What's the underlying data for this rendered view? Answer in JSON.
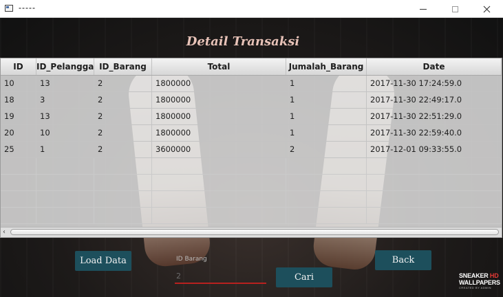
{
  "window": {
    "title": "-----"
  },
  "page": {
    "heading": "Detail Transaksi"
  },
  "table": {
    "columns": [
      "ID",
      "ID_Pelanggan",
      "ID_Barang",
      "Total",
      "Jumalah_Barang",
      "Date"
    ],
    "rows": [
      [
        "10",
        "13",
        "2",
        "1800000",
        "1",
        "2017-11-30 17:24:59.0"
      ],
      [
        "18",
        "3",
        "2",
        "1800000",
        "1",
        "2017-11-30 22:49:17.0"
      ],
      [
        "19",
        "13",
        "2",
        "1800000",
        "1",
        "2017-11-30 22:51:29.0"
      ],
      [
        "20",
        "10",
        "2",
        "1800000",
        "1",
        "2017-11-30 22:59:40.0"
      ],
      [
        "25",
        "1",
        "2",
        "3600000",
        "2",
        "2017-12-01 09:33:55.0"
      ]
    ]
  },
  "controls": {
    "load_label": "Load Data",
    "back_label": "Back",
    "cari_label": "Cari",
    "id_barang_label": "ID Barang",
    "id_barang_value": "2"
  },
  "brand": {
    "line1": "SNEAKER",
    "line1_hd": "HD",
    "line2": "WALLPAPERS",
    "line3": "CREATED BY ADMIN"
  },
  "colors": {
    "accent_button": "#1d4f5c",
    "field_underline": "#b9211f",
    "heading": "#e8c3b8"
  }
}
